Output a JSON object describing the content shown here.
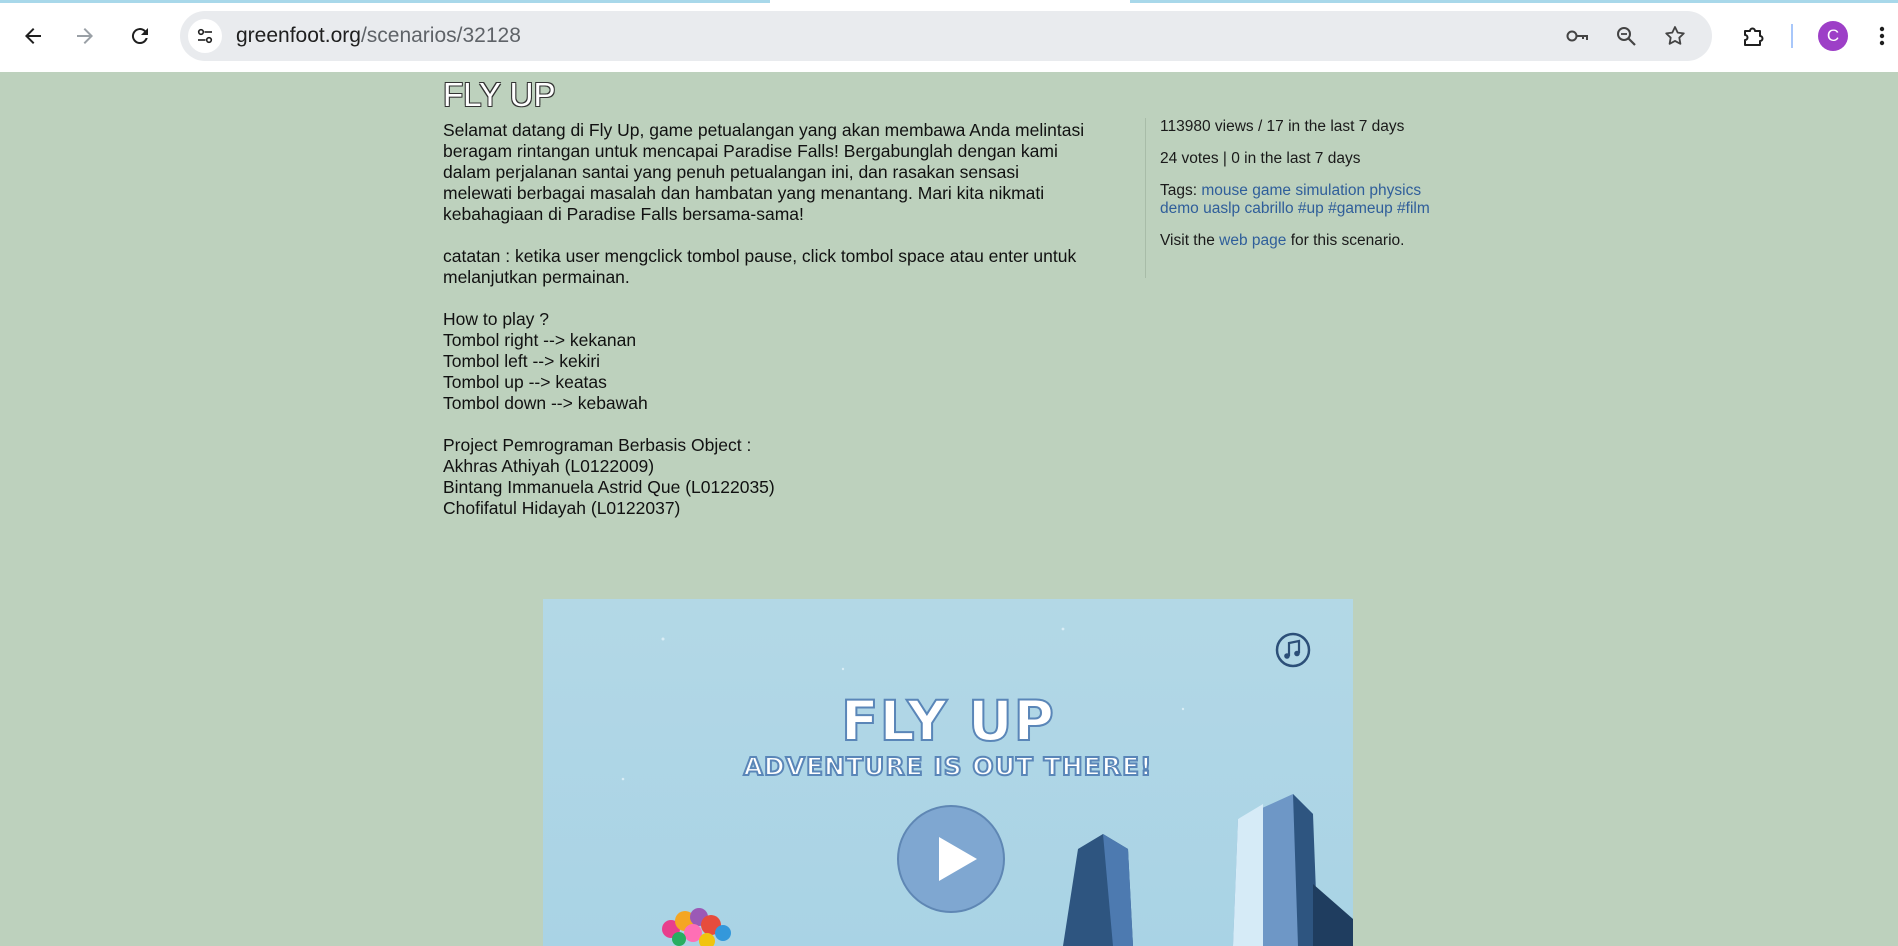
{
  "browser": {
    "url_host": "greenfoot.org",
    "url_path": "/scenarios/32128",
    "avatar_letter": "C",
    "icons": [
      "back-icon",
      "forward-icon",
      "reload-icon",
      "site-info-icon",
      "key-icon",
      "zoom-icon",
      "bookmark-star-icon",
      "extensions-icon",
      "menu-dots-icon"
    ]
  },
  "scenario": {
    "title": "FLY UP",
    "description": [
      [
        "Selamat datang di Fly Up, game petualangan yang akan membawa Anda melintasi",
        "beragam rintangan untuk mencapai Paradise Falls! Bergabunglah dengan kami",
        "dalam perjalanan santai yang penuh petualangan ini, dan rasakan sensasi",
        "melewati berbagai masalah dan hambatan yang menantang. Mari kita nikmati",
        "kebahagiaan di Paradise Falls bersama-sama!"
      ],
      [
        "catatan : ketika user mengclick tombol pause, click tombol space atau enter untuk",
        "melanjutkan permainan."
      ],
      [
        "How to play ?",
        "Tombol right --> kekanan",
        "Tombol left --> kekiri",
        "Tombol up --> keatas",
        "Tombol down --> kebawah"
      ],
      [
        "Project Pemrograman Berbasis Object :",
        "Akhras Athiyah (L0122009)",
        "Bintang Immanuela Astrid Que (L0122035)",
        "Chofifatul Hidayah (L0122037)"
      ]
    ]
  },
  "stats": {
    "views": "113980 views / 17 in the last 7 days",
    "votes": "24 votes | 0 in the last 7 days",
    "tags_label": "Tags:",
    "tags": [
      "mouse",
      "game",
      "simulation",
      "physics",
      "demo",
      "uaslp",
      "cabrillo",
      "#up",
      "#gameup",
      "#film"
    ],
    "visit_prefix": "Visit the",
    "visit_link": "web page",
    "visit_suffix": "for this scenario."
  },
  "game": {
    "title": "FLY UP",
    "subtitle": "ADVENTURE IS OUT THERE!",
    "icons": [
      "music-icon",
      "play-icon",
      "balloons-icon"
    ]
  },
  "colors": {
    "page_bg": "#bdd1bd",
    "link": "#2f5e9a",
    "game_sky": "#b3d8e6",
    "avatar": "#9d3fc7"
  }
}
